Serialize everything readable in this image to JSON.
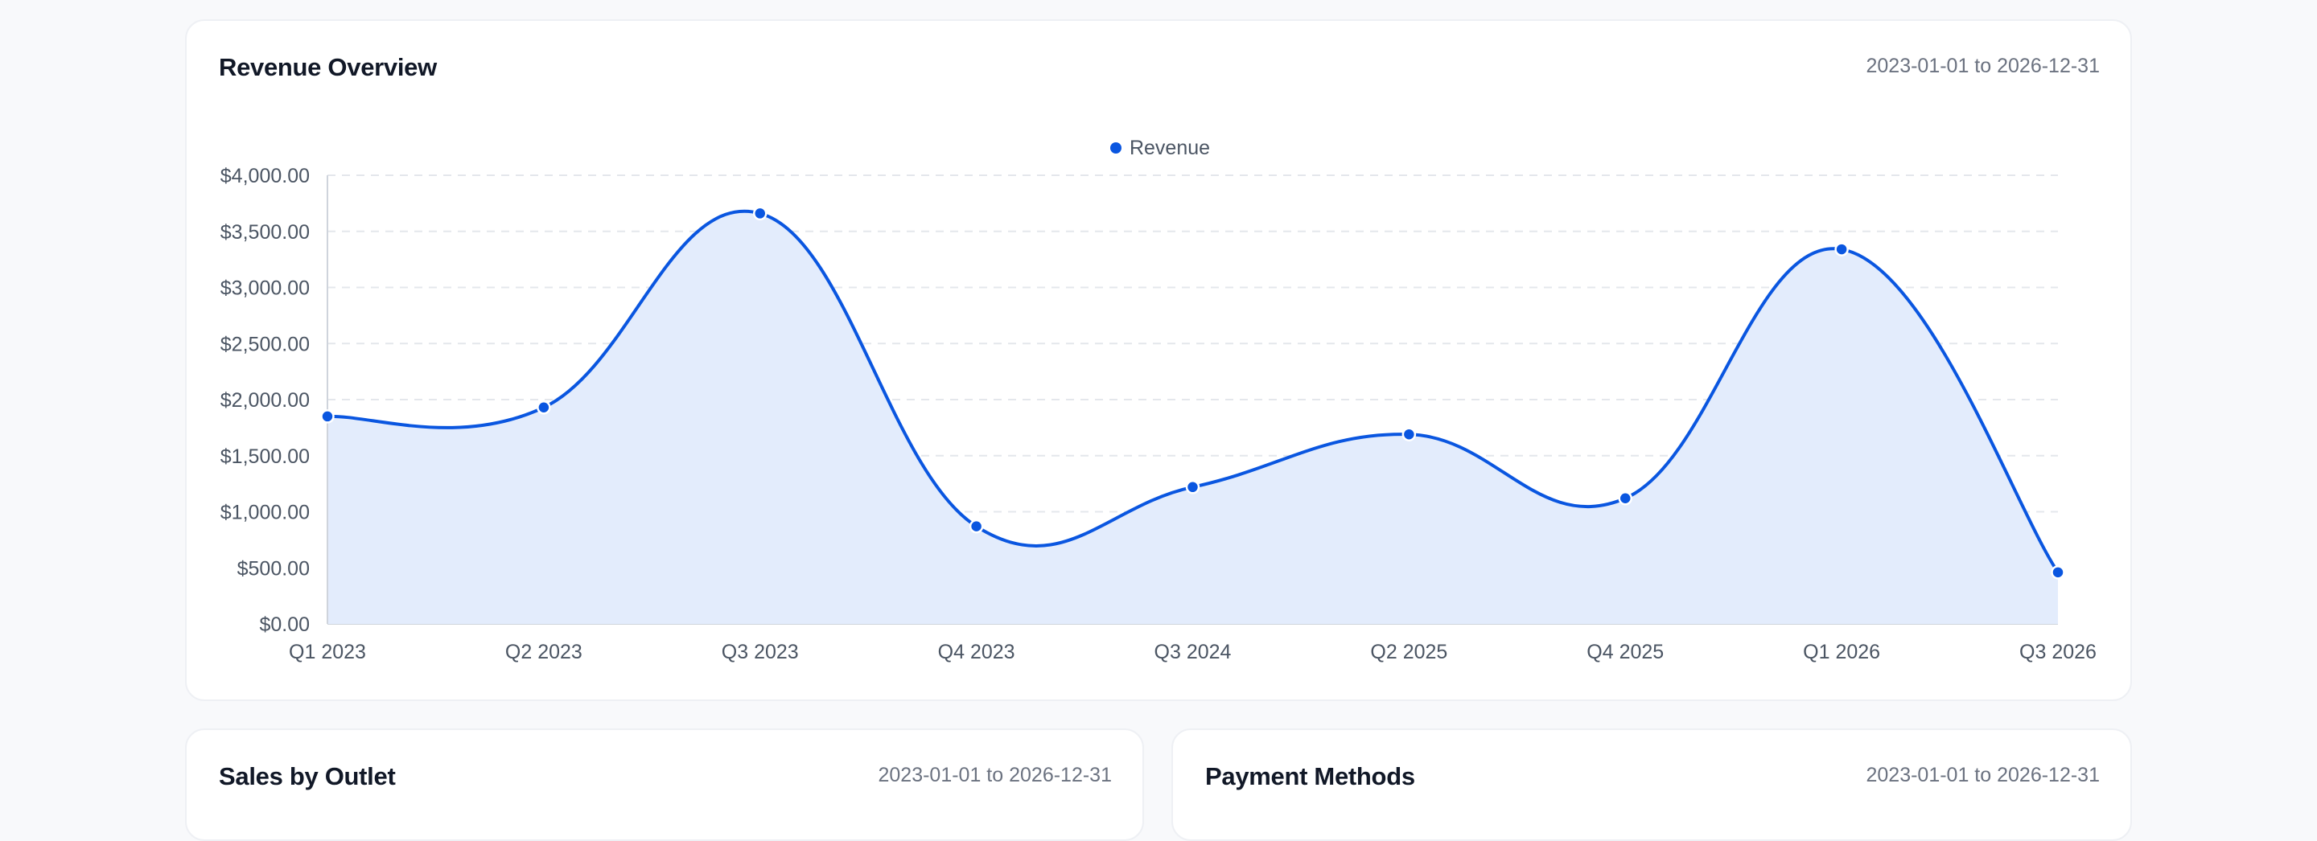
{
  "colors": {
    "accent": "#0a56e0",
    "area_fill": "#e3ecfc",
    "grid": "#e4e7ec",
    "tick_text": "#4b5563"
  },
  "revenue_card": {
    "title": "Revenue Overview",
    "date_range": "2023-01-01 to 2026-12-31"
  },
  "outlet_card": {
    "title": "Sales by Outlet",
    "date_range": "2023-01-01 to 2026-12-31"
  },
  "payment_card": {
    "title": "Payment Methods",
    "date_range": "2023-01-01 to 2026-12-31"
  },
  "chart_data": {
    "type": "area",
    "categories": [
      "Q1 2023",
      "Q2 2023",
      "Q3 2023",
      "Q4 2023",
      "Q3 2024",
      "Q2 2025",
      "Q4 2025",
      "Q1 2026",
      "Q3 2026"
    ],
    "series": [
      {
        "name": "Revenue",
        "values": [
          1850,
          1930,
          3660,
          870,
          1220,
          1690,
          1120,
          3340,
          460
        ]
      }
    ],
    "yticks": [
      "$0.00",
      "$500.00",
      "$1,000.00",
      "$1,500.00",
      "$2,000.00",
      "$2,500.00",
      "$3,000.00",
      "$3,500.00",
      "$4,000.00"
    ],
    "ylim": [
      0,
      4000
    ],
    "grid": true,
    "legend_position": "top-center"
  }
}
